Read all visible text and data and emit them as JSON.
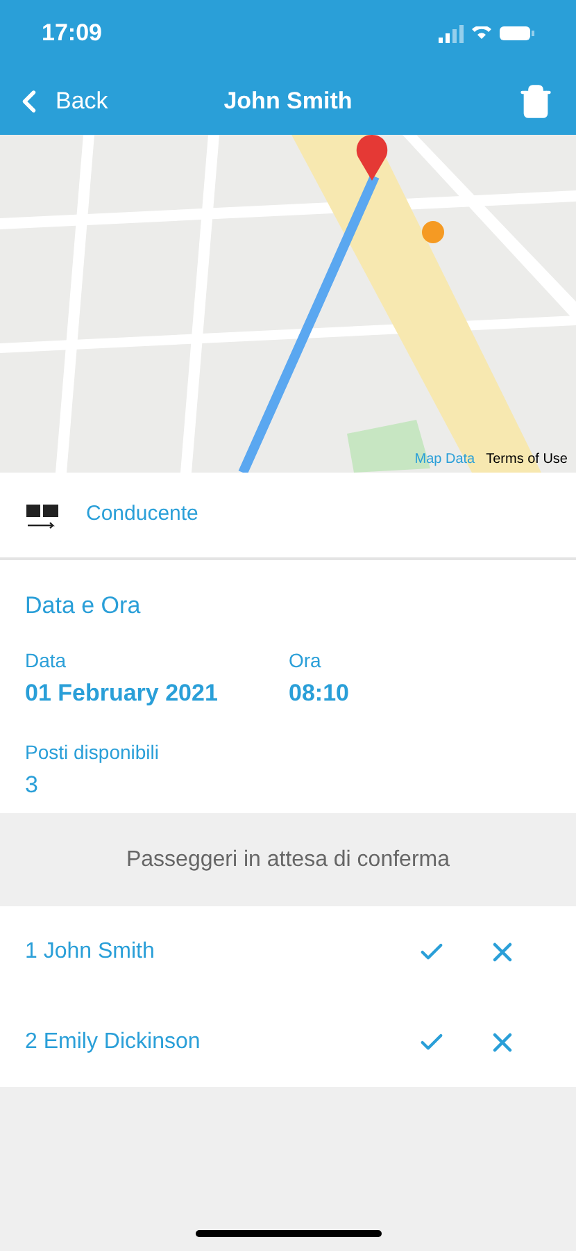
{
  "status_bar": {
    "time": "17:09"
  },
  "nav": {
    "back": "Back",
    "title": "John Smith"
  },
  "map": {
    "kind": "picture",
    "links": [
      "Map Data",
      "Terms of Use"
    ]
  },
  "driver": {
    "label": "Conducente"
  },
  "details": {
    "title": "Data e Ora",
    "fields": [
      {
        "label": "Data",
        "value": "01 February 2021"
      },
      {
        "label": "Ora",
        "value": "08:10"
      }
    ],
    "seats": {
      "label": "Posti disponibili",
      "value": "3"
    }
  },
  "pending": {
    "title": "Passeggeri in attesa di conferma",
    "passengers": [
      {
        "name": "1 John Smith"
      },
      {
        "name": "2 Emily Dickinson"
      }
    ]
  }
}
